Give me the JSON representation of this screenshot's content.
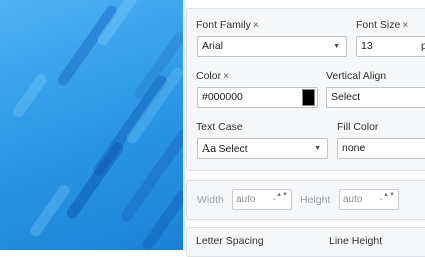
{
  "font_family": {
    "label": "Font Family",
    "remove_icon": "×",
    "value": "Arial"
  },
  "font_size": {
    "label": "Font Size",
    "remove_icon": "×",
    "value": "13",
    "unit": "p"
  },
  "color": {
    "label": "Color",
    "remove_icon": "×",
    "value": "#000000",
    "swatch_color": "#000000"
  },
  "vertical_align": {
    "label": "Vertical Align",
    "value": "Select"
  },
  "text_case": {
    "label": "Text Case",
    "icon_text": "Aa",
    "value": "Select"
  },
  "fill_color": {
    "label": "Fill Color",
    "value": "none"
  },
  "width": {
    "label": "Width",
    "value": "auto",
    "separator": "-"
  },
  "height": {
    "label": "Height",
    "value": "auto",
    "separator": "-"
  },
  "letter_spacing": {
    "label": "Letter Spacing"
  },
  "line_height": {
    "label": "Line Height"
  },
  "icons": {
    "caret": "▼",
    "spinner": "▲▼",
    "remove": "close-icon"
  }
}
